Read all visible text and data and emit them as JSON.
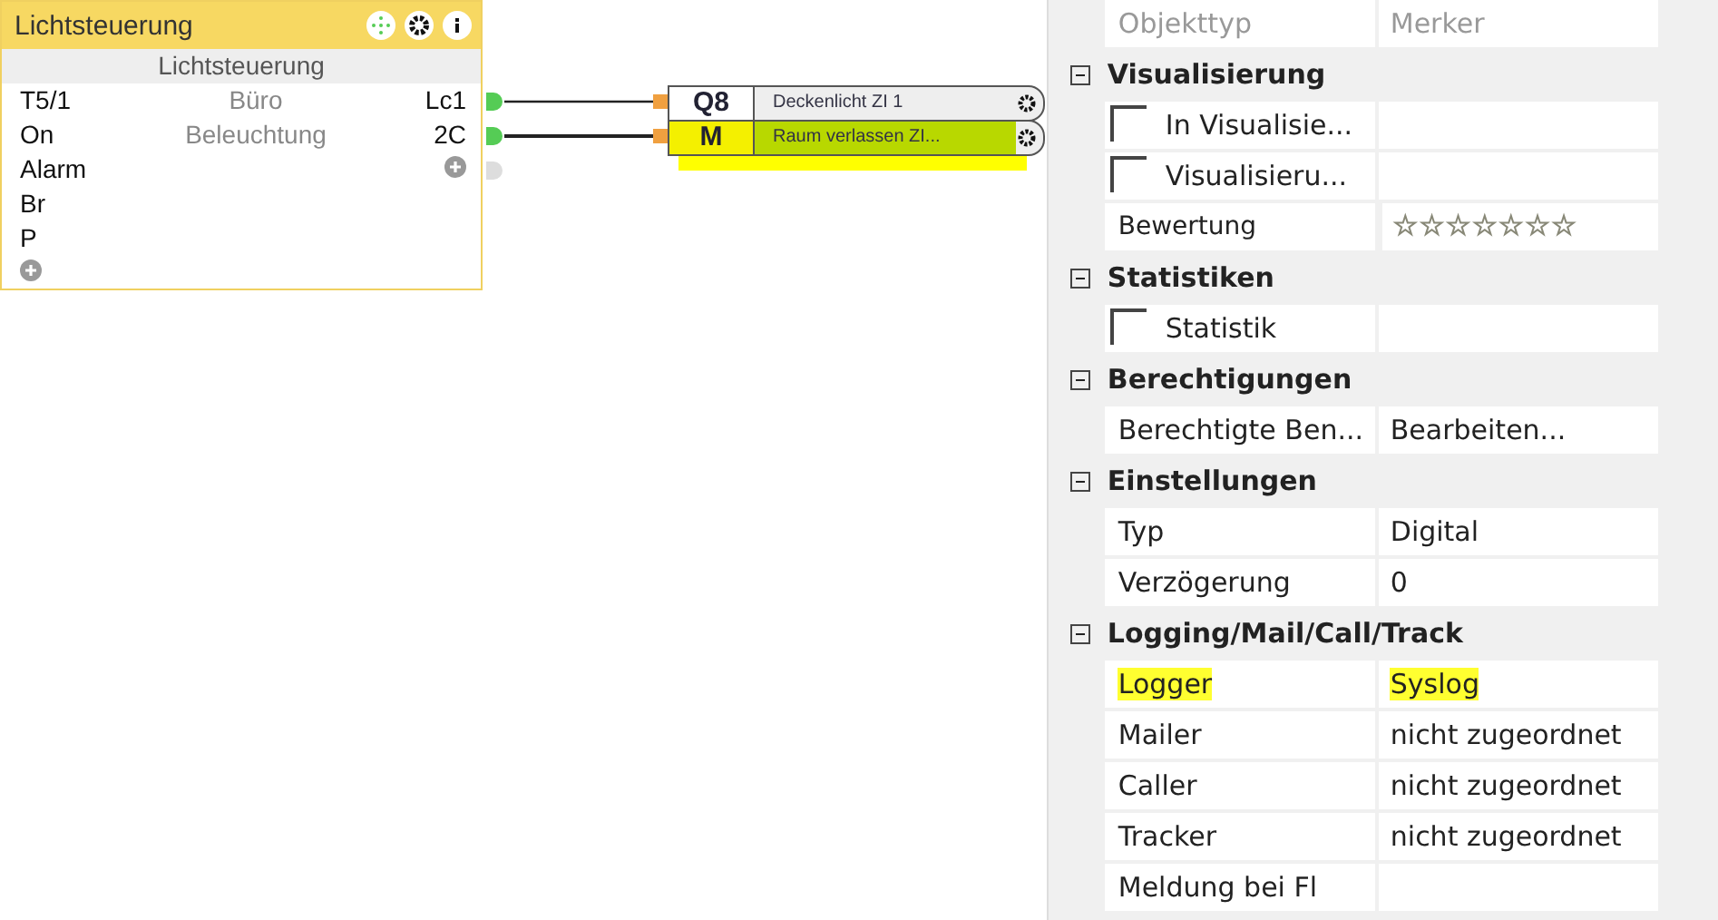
{
  "block": {
    "title": "Lichtsteuerung",
    "subtitle": "Lichtsteuerung",
    "inputs": [
      "T5/1",
      "On",
      "Alarm",
      "Br",
      "P"
    ],
    "center": [
      "Büro",
      "Beleuchtung"
    ],
    "outputs": [
      {
        "label": "Lc1",
        "connected": true
      },
      {
        "label": "2C",
        "connected": true
      },
      {
        "connected": false
      }
    ]
  },
  "targets": [
    {
      "code": "Q8",
      "name": "Deckenlicht ZI 1",
      "highlighted": false
    },
    {
      "code": "M",
      "name": "Raum verlassen ZI...",
      "highlighted": true
    }
  ],
  "properties": [
    {
      "kind": "row",
      "label": "Objekttyp",
      "value": "Merker",
      "disabled": true,
      "highlighted": false
    },
    {
      "kind": "group",
      "label": "Visualisierung",
      "expanded": true
    },
    {
      "kind": "check",
      "label": "In Visualisie...",
      "checked": false
    },
    {
      "kind": "check",
      "label": "Visualisieru...",
      "checked": false
    },
    {
      "kind": "stars",
      "label": "Bewertung",
      "stars": 0
    },
    {
      "kind": "group",
      "label": "Statistiken",
      "expanded": true
    },
    {
      "kind": "check",
      "label": "Statistik",
      "checked": false
    },
    {
      "kind": "group",
      "label": "Berechtigungen",
      "expanded": true
    },
    {
      "kind": "row",
      "label": "Berechtigte Ben...",
      "value": "Bearbeiten...",
      "disabled": false,
      "highlighted": false
    },
    {
      "kind": "group",
      "label": "Einstellungen",
      "expanded": true
    },
    {
      "kind": "row",
      "label": "Typ",
      "value": "Digital",
      "disabled": false,
      "highlighted": false
    },
    {
      "kind": "row",
      "label": "Verzögerung",
      "value": "0",
      "disabled": false,
      "highlighted": false
    },
    {
      "kind": "group",
      "label": "Logging/Mail/Call/Track",
      "expanded": true
    },
    {
      "kind": "row",
      "label": "Logger",
      "value": "Syslog",
      "disabled": false,
      "highlighted": true
    },
    {
      "kind": "row",
      "label": "Mailer",
      "value": "nicht zugeordnet",
      "disabled": false,
      "highlighted": false
    },
    {
      "kind": "row",
      "label": "Caller",
      "value": "nicht zugeordnet",
      "disabled": false,
      "highlighted": false
    },
    {
      "kind": "row",
      "label": "Tracker",
      "value": "nicht zugeordnet",
      "disabled": false,
      "highlighted": false
    },
    {
      "kind": "row",
      "label": "Meldung bei Fl",
      "disabled": false,
      "highlighted": false
    }
  ]
}
